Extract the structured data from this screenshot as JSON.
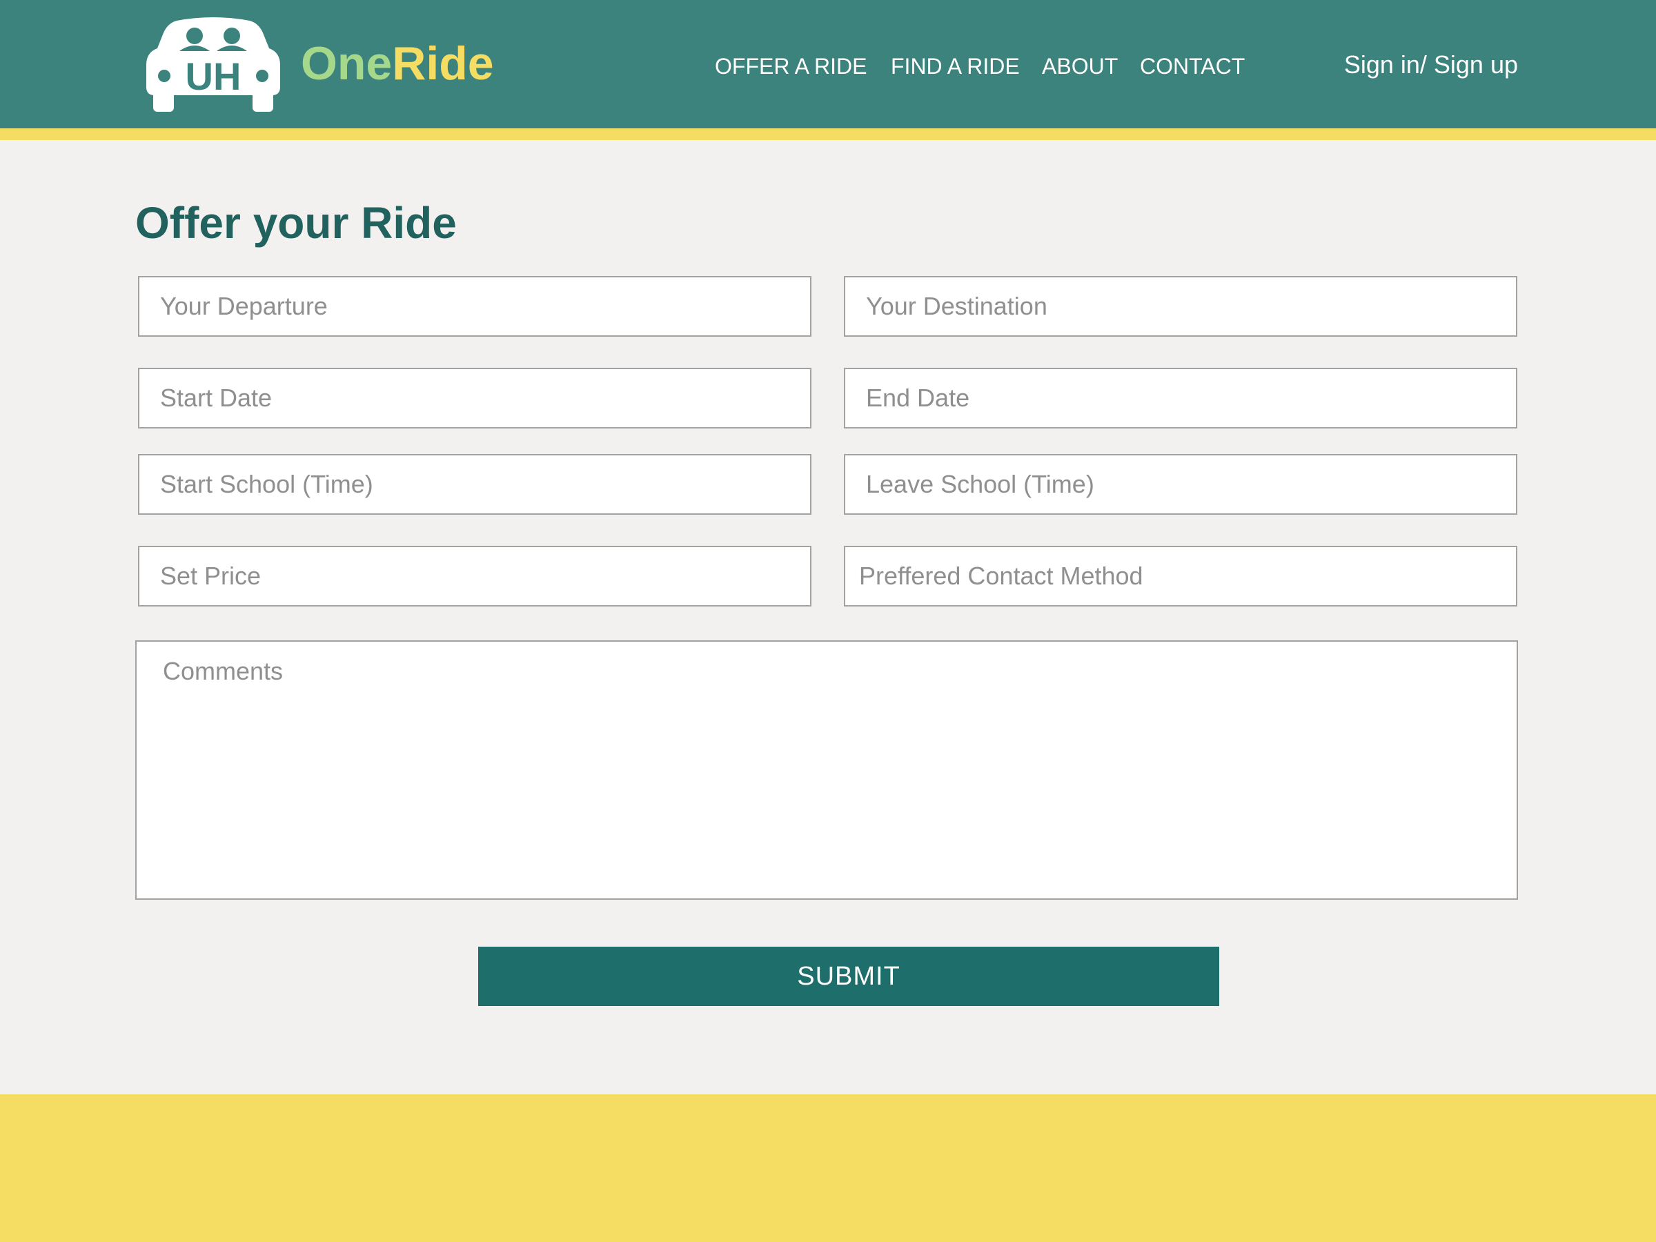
{
  "colors": {
    "header_bg": "#3d837d",
    "accent_yellow": "#f5dc62",
    "brand_green": "#a6d88c",
    "title_teal": "#21625e",
    "button_teal": "#1e6f6c",
    "page_bg": "#f2f1ef"
  },
  "header": {
    "logo_text": "UH",
    "logo_icon": "car-icon",
    "brand_part1": "One",
    "brand_part2": "Ride",
    "nav": [
      {
        "label": "OFFER A RIDE"
      },
      {
        "label": "FIND A RIDE"
      },
      {
        "label": "ABOUT"
      },
      {
        "label": "CONTACT"
      }
    ],
    "signin": "Sign in/ Sign up"
  },
  "form": {
    "title": "Offer your Ride",
    "fields": {
      "departure": "Your Departure",
      "destination": "Your Destination",
      "start_date": "Start Date",
      "end_date": "End Date",
      "start_school": "Start School (Time)",
      "leave_school": "Leave School (Time)",
      "price": "Set Price",
      "contact_method": "Preffered Contact Method",
      "comments": "Comments"
    },
    "submit_label": "SUBMIT"
  }
}
